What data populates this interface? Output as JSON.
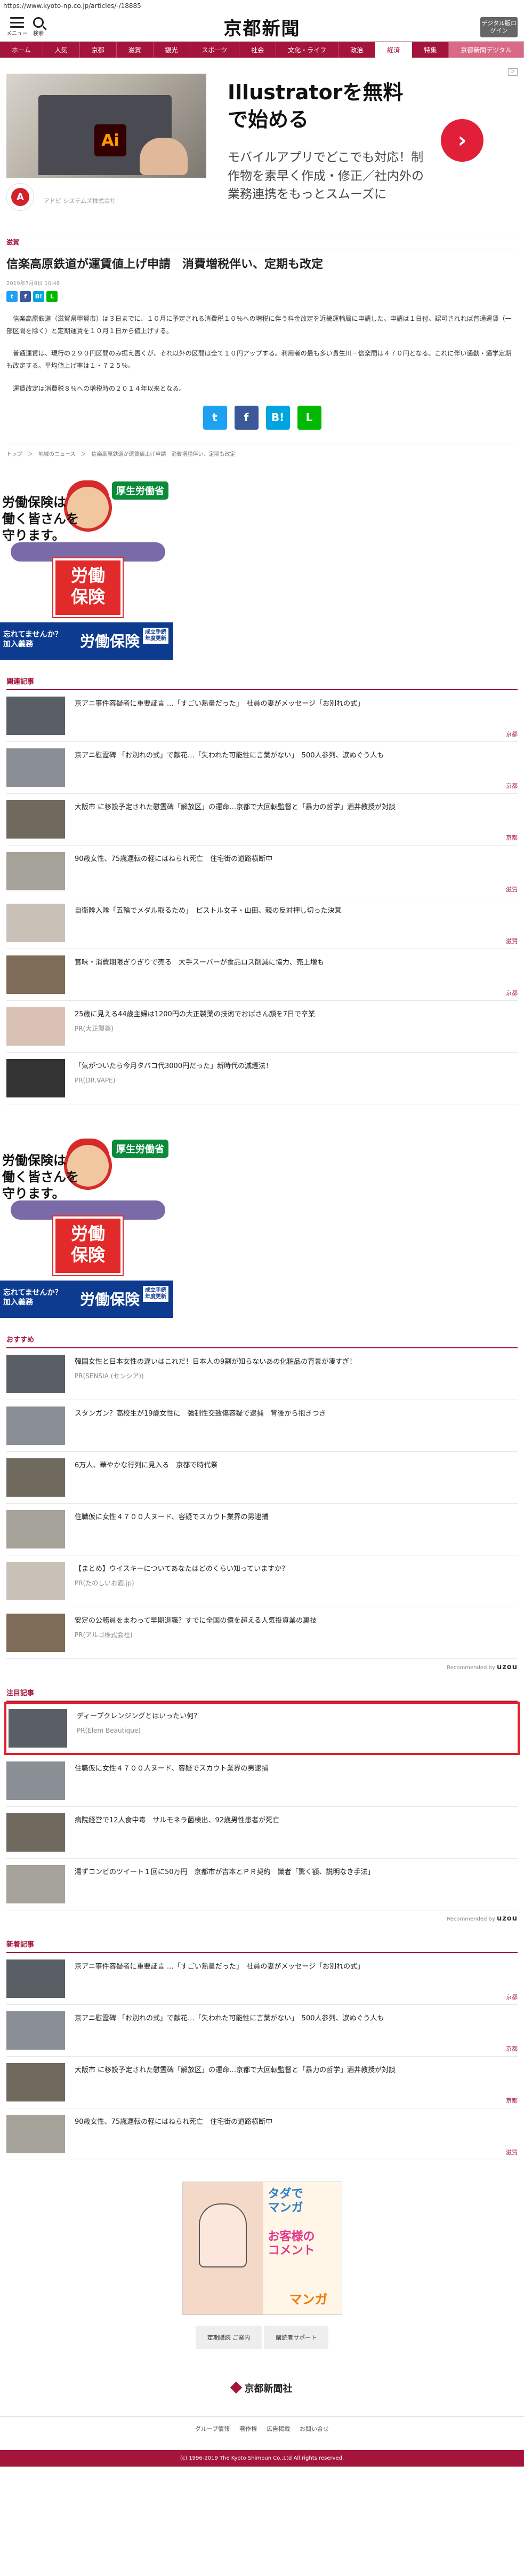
{
  "browser": {
    "url": "https://www.kyoto-np.co.jp/articles/-/18885"
  },
  "header": {
    "menu_label": "メニュー",
    "search_label": "検索",
    "logo_text": "京都新聞",
    "digital_button": "デジタル版ログイン"
  },
  "nav": {
    "items": [
      "ホーム",
      "人気",
      "京都",
      "滋賀",
      "観光",
      "スポーツ",
      "社会",
      "文化・ライフ",
      "政治",
      "経済",
      "特集",
      "京都新聞デジタル"
    ]
  },
  "top_ad": {
    "title": "Illustratorを無料で始める",
    "description": "モバイルアプリでどこでも対応！制作物を素早く作成・修正／社内外の業務連携をもっとスムーズに",
    "sponsor": "アドビ システムズ株式会社",
    "badge": "Ai",
    "adobe_mark": "A"
  },
  "article": {
    "category": "滋賀",
    "headline": "信楽高原鉄道が運賃値上げ申請　消費増税伴い、定期も改定",
    "date": "2019年7月8日 10:48",
    "paragraphs": [
      "信楽高原鉄道（滋賀県甲賀市）は３日までに、１０月に予定される消費税１０％への増税に伴う料金改定を近畿運輸局に申請した。申請は１日付。認可されれば普通運賃（一部区間を除く）と定期運賃を１０月１日から値上げする。",
      "普通運賃は、現行の２９０円区間のみ据え置くが、それ以外の区間は全て１０円アップする。利用者の最も多い貴生川－信楽間は４７０円となる。これに伴い通勤・通学定期も改定する。平均値上げ率は１・７２５％。",
      "運賃改定は消費税８％への増税時の２０１４年以来となる。"
    ],
    "breadcrumbs": "トップ　＞　地域のニュース　＞　信楽高原鉄道が運賃値上げ申請　消費増税伴い、定期も改定",
    "share": {
      "twitter": "t",
      "facebook": "f",
      "hatena": "B!",
      "line": "L"
    }
  },
  "poster_ad": {
    "headline": "労働保険は\n働く皆さんを\n守ります。",
    "logo": "厚生労働省",
    "sign": "労働\n保険",
    "bottom_left": "忘れてませんか？\n加入義務",
    "bottom_right": "労働保険",
    "tag": "成立手続\n年度更新"
  },
  "related": {
    "title": "関連記事",
    "items": [
      {
        "text": "京アニ事件容疑者に重要証言 …「すごい熱量だった」 社員の妻がメッセージ「お別れの式」",
        "tag": "京都"
      },
      {
        "text": "京アニ",
        "tag": ""
      }
    ]
  },
  "related_list": {
    "title": "関連記事",
    "items": [
      {
        "text": "京アニ事件容疑者に重要証言 …「すごい熱量だった」　社員の妻がメッセージ「お別れの式」",
        "tag": "京都",
        "src": ""
      },
      {
        "text": "京アニ慰霊碑 「お別れの式」で献花…「失われた可能性に言葉がない」　500人参列、涙ぬぐう人も",
        "tag": "京都",
        "src": ""
      },
      {
        "text": "大阪市 に移設予定された慰霊碑「解放区」の運命…京都で大回転監督と「暴力の哲学」酒井教授が対談",
        "tag": "京都",
        "src": ""
      },
      {
        "text": "90歳女性、75歳運転の軽にはねられ死亡　住宅街の道路横断中",
        "tag": "滋賀",
        "src": ""
      },
      {
        "text": "自衛隊入隊「五輪でメダル取るため」　ピストル女子・山田、親の反対押し切った決意",
        "tag": "滋賀",
        "src": ""
      },
      {
        "text": "賞味・消費期限ぎりぎりで売る　大手スーパーが食品ロス削減に協力、売上増も",
        "tag": "京都",
        "src": ""
      },
      {
        "text": "25歳に見える44歳主婦は1200円の大正製薬の技術でおばさん顔を7日で卒業",
        "tag": "",
        "src": "PR(大正製薬)"
      },
      {
        "text": "「気がついたら今月タバコ代3000円だった」新時代の減煙法！",
        "tag": "",
        "src": "PR(DR.VAPE)"
      }
    ]
  },
  "recommended": {
    "title": "おすすめ",
    "items": [
      {
        "text": "韓国女性と日本女性の違いはこれだ！日本人の9割が知らないあの化粧品の背景が凄すぎ！",
        "src": "PR(SENSIA (センシア))"
      },
      {
        "text": "スタンガン？高校生が19歳女性に　強制性交致傷容疑で逮捕　背後から抱きつき",
        "src": ""
      },
      {
        "text": "6万人、華やかな行列に見入る　京都で時代祭",
        "src": ""
      },
      {
        "text": "住職仮に女性４７００人ヌード、容疑でスカウト業界の男逮捕",
        "src": ""
      },
      {
        "text": "【まとめ】ウイスキーについてあなたはどのくらい知っていますか？",
        "src": "PR(たのしいお酒.jp)"
      },
      {
        "text": "安定の公務員をまわって早期退職？すでに全国の億を超える人気投資業の裏技",
        "src": "PR(アルゴ株式会社)"
      }
    ],
    "by": "Recommended by",
    "brand": "uzou"
  },
  "popular": {
    "title": "注目記事",
    "items": [
      {
        "text": "ディープクレンジングとはいったい何？",
        "src": "PR(Elem Beautique)"
      },
      {
        "text": "住職仮に女性４７００人ヌード、容疑でスカウト業界の男逮捕",
        "src": ""
      },
      {
        "text": "病院経営で12人食中毒　サルモネラ菌検出、92歳男性患者が死亡",
        "src": ""
      },
      {
        "text": "湯ずコンビのツイート１回に50万円　京都市が吉本とＰＲ契約　識者「驚く額、説明なき手法」",
        "src": ""
      }
    ],
    "by": "Recommended by",
    "brand": "uzou"
  },
  "latest": {
    "title": "新着記事",
    "items": [
      {
        "text": "京アニ事件容疑者に重要証言 …「すごい熱量だった」　社員の妻がメッセージ「お別れの式」",
        "tag": "京都"
      },
      {
        "text": "京アニ慰霊碑 「お別れの式」で献花…「失われた可能性に言葉がない」　500人参列、涙ぬぐう人も",
        "tag": "京都"
      },
      {
        "text": "大阪市 に移設予定された慰霊碑「解放区」の運命…京都で大回転監督と「暴力の哲学」酒井教授が対談",
        "tag": "京都"
      },
      {
        "text": "90歳女性、75歳運転の軽にはねられ死亡　住宅街の道路横断中",
        "tag": "滋賀"
      }
    ]
  },
  "manga_ad": {
    "text_a": "タダで\nマンガ",
    "text_b": "お客様の\nコメント",
    "text_c": "マンガ"
  },
  "footer_buttons": [
    "定期購読 ご案内",
    "購読者サポート"
  ],
  "footer_logo": "京都新聞社",
  "footer_links": [
    "グループ情報",
    "著作権",
    "広告掲載",
    "お問い合せ"
  ],
  "copyright": "(c) 1996-2019 The Kyoto Shimbun Co.,Ltd All rights reserved.",
  "colors": {
    "brand": "#a5153b",
    "highlight": "#e0202b",
    "twitter": "#1da1f2",
    "facebook": "#3b5998",
    "hatena": "#00a4de",
    "line": "#00b900"
  }
}
